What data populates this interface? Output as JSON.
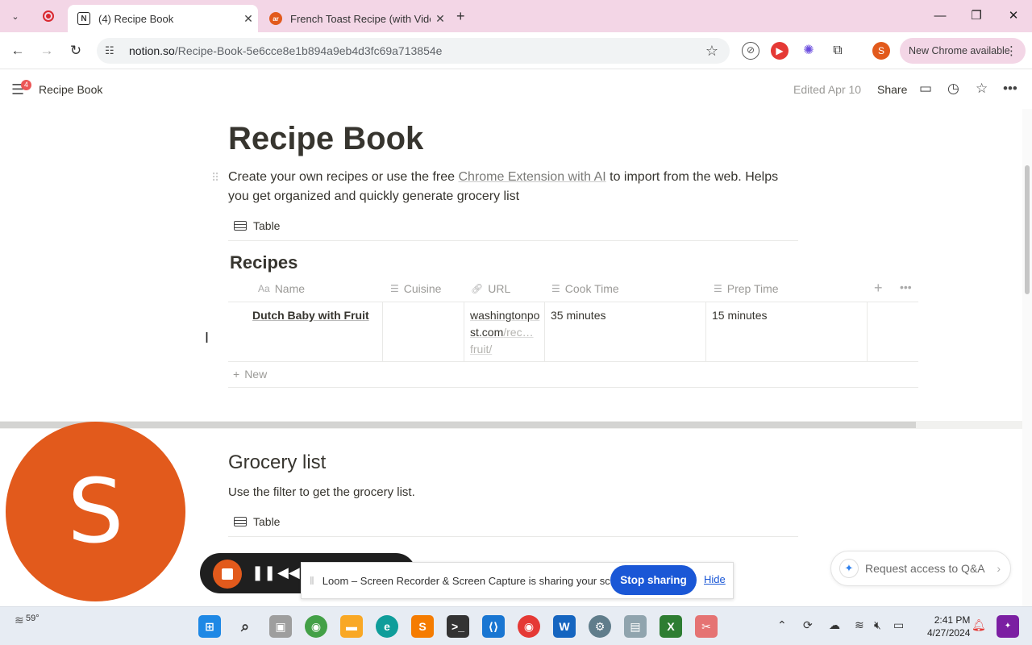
{
  "browser": {
    "tabs": [
      {
        "title": "(4) Recipe Book",
        "favicon": "notion-icon",
        "active": true
      },
      {
        "title": "French Toast Recipe (with Video)",
        "favicon": "allrecipes-icon",
        "active": false
      }
    ],
    "url_host": "notion.so",
    "url_path": "/Recipe-Book-5e6cce8e1b894a9eb4d3fc69a713854e",
    "new_chrome_label": "New Chrome available",
    "profile_initial": "S"
  },
  "notion": {
    "notification_count": "4",
    "breadcrumb": "Recipe Book",
    "edited": "Edited Apr 10",
    "share_label": "Share"
  },
  "page": {
    "title": "Recipe Book",
    "desc_before": "Create your own recipes or use the free ",
    "desc_link": "Chrome Extension with AI",
    "desc_after": " to import from the web. Helps you get organized and quickly generate grocery list",
    "view_label": "Table",
    "db_title": "Recipes",
    "columns": [
      "Name",
      "Cuisine",
      "URL",
      "Cook Time",
      "Prep Time"
    ],
    "rows": [
      {
        "name": "Dutch Baby with Fruit",
        "cuisine": "",
        "url_main": "washingtonpost.com",
        "url_dim": "/rec…",
        "url_tail": "fruit/",
        "cook_time": "35 minutes",
        "prep_time": "15 minutes"
      }
    ],
    "new_label": "New",
    "grocery_title": "Grocery list",
    "grocery_desc": "Use the filter to get the grocery list.",
    "grocery_view_label": "Table"
  },
  "loom": {
    "avatar_initial": "S",
    "share_message": "Loom – Screen Recorder & Screen Capture is sharing your screen.",
    "stop_label": "Stop sharing",
    "hide_label": "Hide",
    "accent": "#1a57d6",
    "avatar_color": "#e25a1c"
  },
  "qna": {
    "label": "Request access to Q&A"
  },
  "taskbar": {
    "temperature": "59°",
    "time": "2:41 PM",
    "date": "4/27/2024"
  }
}
